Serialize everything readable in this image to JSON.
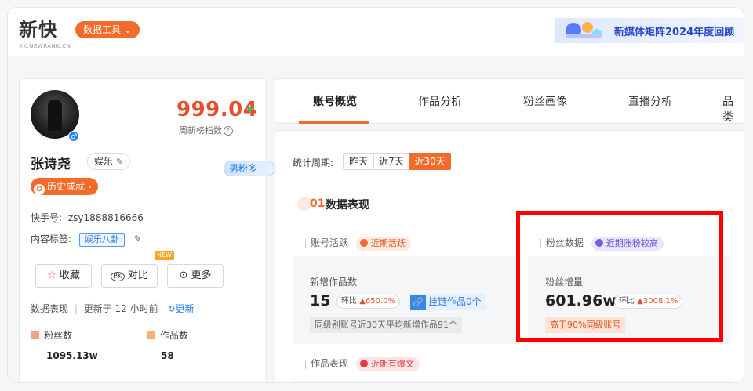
{
  "header": {
    "logo_cn": "新快",
    "logo_en": "XK.NEWRANK.CN",
    "tools_button": "数据工具",
    "banner_text": "新媒体矩阵2024年度回顾"
  },
  "profile": {
    "name": "张诗尧",
    "category": "娱乐",
    "score": "999.04",
    "score_label": "周新榜指数",
    "gender_badge": "男粉多",
    "history": "历史成就",
    "account_label": "快手号:",
    "account_id": "zsy1888816666",
    "tags_label": "内容标签:",
    "tag": "娱乐八卦",
    "buttons": {
      "collect": "收藏",
      "compare": "对比",
      "more": "更多"
    },
    "new_tag": "NEW",
    "update_label": "数据表现",
    "update_time": "更新于 12 小时前",
    "refresh": "更新",
    "fans_label": "粉丝数",
    "fans_value": "1095.13w",
    "works_label": "作品数",
    "works_value": "58"
  },
  "tabs": [
    "账号概览",
    "作品分析",
    "粉丝画像",
    "直播分析",
    "品类"
  ],
  "main": {
    "period_label": "统计周期:",
    "periods": [
      "昨天",
      "近7天",
      "近30天"
    ],
    "selected_period": "近30天",
    "section_num": "01",
    "section_title": "数据表现",
    "activity": {
      "title": "账号活跃",
      "pill": "近期活跃",
      "metric_title": "新增作品数",
      "metric_value": "15",
      "huanbi_label": "环比",
      "huanbi_value": "650.0%",
      "link_text": "挂链作品0个",
      "note": "同级别账号近30天平均新增作品91个"
    },
    "fans": {
      "title": "粉丝数据",
      "pill": "近期涨粉较高",
      "metric_title": "粉丝增量",
      "metric_value": "601.96w",
      "huanbi_label": "环比",
      "huanbi_value": "3008.1%",
      "note": "高于90%同级账号"
    },
    "works": {
      "title": "作品表现",
      "pill": "近期有爆文"
    }
  },
  "colors": {
    "accent": "#f26b2b",
    "score": "#e94e2c",
    "highlight": "#ff0000",
    "link": "#2a7ee8"
  }
}
